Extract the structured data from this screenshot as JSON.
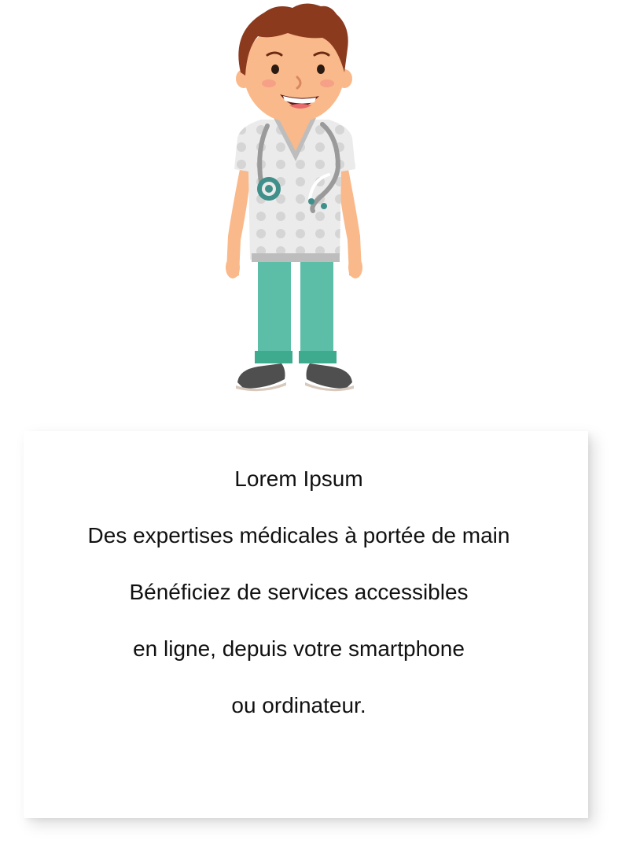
{
  "card": {
    "title": "Lorem Ipsum",
    "subtitle": "Des expertises médicales à portée de main",
    "line1": "Bénéficiez de services accessibles",
    "line2": "en ligne, depuis votre smartphone",
    "line3": "ou ordinateur."
  },
  "illustration": {
    "icon": "doctor-illustration-icon",
    "colors": {
      "hair": "#8B3A1E",
      "skin": "#F9B98A",
      "scrubs_top": "#EBEBEB",
      "scrubs_dots": "#D5D5D5",
      "pants": "#5DBEA8",
      "cuffs": "#3EAA8E",
      "shoes": "#4F4F4F",
      "stethoscope": "#9A9A9A",
      "stethoscope_head": "#3F8F8A"
    }
  }
}
